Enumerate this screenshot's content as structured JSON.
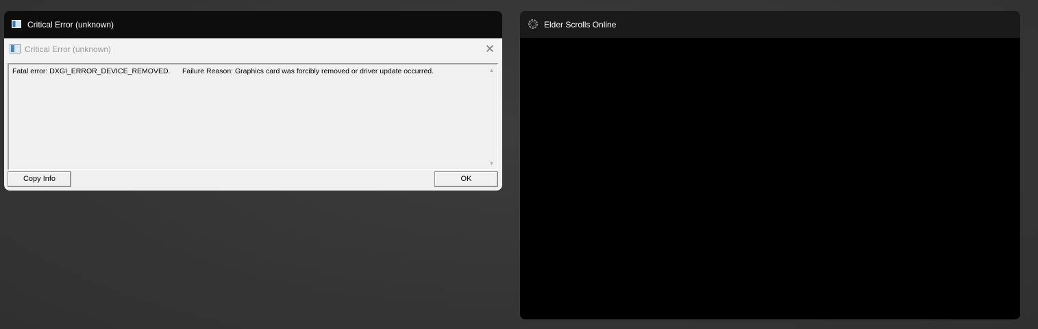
{
  "left_window": {
    "title": "Critical Error (unknown)",
    "icon": "app-window-icon",
    "dialog": {
      "title": "Critical Error (unknown)",
      "close_glyph": "✕",
      "message": "Fatal error: DXGI_ERROR_DEVICE_REMOVED.      Failure Reason: Graphics card was forcibly removed or driver update occurred.",
      "scroll_up_glyph": "▲",
      "scroll_down_glyph": "▼",
      "buttons": {
        "copy_info": "Copy Info",
        "ok": "OK"
      }
    }
  },
  "right_window": {
    "title": "Elder Scrolls Online",
    "icon": "eso-ring-icon"
  },
  "colors": {
    "desktop_bg": "#363636",
    "card_header_dark": "#0d0d0d",
    "dialog_bg": "#f0f0f0",
    "game_bg": "#000000"
  }
}
